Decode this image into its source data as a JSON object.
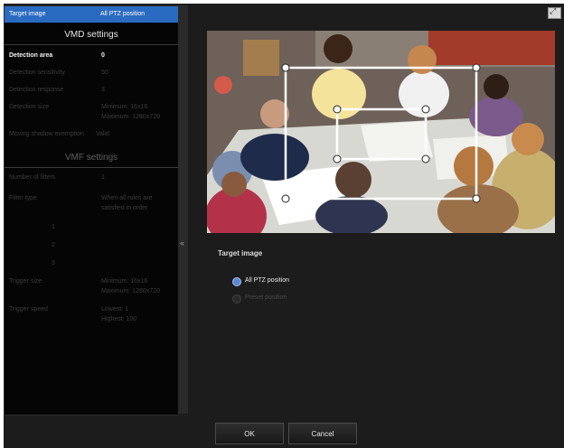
{
  "left_panel": {
    "target": {
      "label": "Target image",
      "value": "All PTZ position"
    },
    "vmd": {
      "title": "VMD settings",
      "detection_area": {
        "label": "Detection area",
        "value": "0"
      },
      "detection_sensitivity": {
        "label": "Detection sensitivity",
        "value": "50"
      },
      "detection_response": {
        "label": "Detection response",
        "value": "3"
      },
      "detection_size": {
        "label": "Detection size",
        "value_line1": "Minimum: 16x16",
        "value_line2": "Maximum: 1280x720"
      },
      "moving_shadow": {
        "label": "Moving shadow exemption",
        "value": "Valid"
      }
    },
    "vmf": {
      "title": "VMF settings",
      "number_of_filters": {
        "label": "Number of filters",
        "value": "1"
      },
      "filter_type": {
        "label": "Filter type",
        "value_line1": "When all rules are",
        "value_line2": "satisfied in order"
      },
      "indices": [
        "1",
        "2",
        "3"
      ],
      "trigger_size": {
        "label": "Trigger size",
        "value_line1": "Minimum: 16x16",
        "value_line2": "Maximum: 1280x720"
      },
      "trigger_speed": {
        "label": "Trigger speed",
        "value_line1": "Lowest: 1",
        "value_line2": "Highest: 100"
      }
    }
  },
  "collapse_arrow": "«",
  "expand_glyph": "⤢",
  "right_panel": {
    "target_label": "Target image",
    "options": [
      {
        "label": "All PTZ position",
        "selected": true
      },
      {
        "label": "Preset position",
        "selected": false
      }
    ]
  },
  "buttons": {
    "ok": "OK",
    "cancel": "Cancel"
  },
  "colors": {
    "selection": "#2a6bc2",
    "radio_on": "#5b86d6",
    "detection_box": "#ffffff"
  }
}
